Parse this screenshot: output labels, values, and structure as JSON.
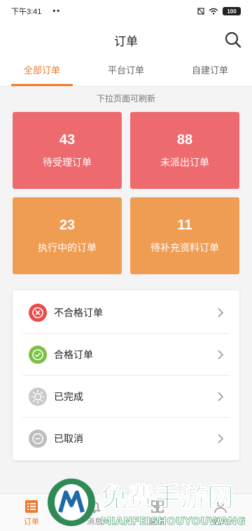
{
  "status_bar": {
    "time": "下午3:41",
    "dots": "••",
    "battery": "100"
  },
  "header": {
    "title": "订单"
  },
  "tabs": [
    {
      "label": "全部订单",
      "active": true
    },
    {
      "label": "平台订单",
      "active": false
    },
    {
      "label": "自建订单",
      "active": false
    }
  ],
  "refresh_hint": "下拉页面可刷新",
  "cards": [
    {
      "count": "43",
      "label": "待受理订单",
      "color": "#ed6b6f"
    },
    {
      "count": "88",
      "label": "未派出订单",
      "color": "#ed6b6f"
    },
    {
      "count": "23",
      "label": "执行中的订单",
      "color": "#f09d54"
    },
    {
      "count": "11",
      "label": "待补充资料订单",
      "color": "#f09d54"
    }
  ],
  "list": [
    {
      "label": "不合格订单",
      "icon": "x-circle-icon",
      "color": "#ea4b4b"
    },
    {
      "label": "合格订单",
      "icon": "check-circle-icon",
      "color": "#7cc242"
    },
    {
      "label": "已完成",
      "icon": "sun-icon",
      "color": "#c9c9c9"
    },
    {
      "label": "已取消",
      "icon": "minus-circle-icon",
      "color": "#bdbdbd"
    }
  ],
  "tabbar": [
    {
      "label": "订单",
      "icon": "order-list-icon",
      "active": true
    },
    {
      "label": "消息",
      "icon": "bell-icon",
      "active": false
    },
    {
      "label": "网络",
      "icon": "grid-icon",
      "active": false
    },
    {
      "label": "我的",
      "icon": "person-icon",
      "active": false
    }
  ],
  "watermark": {
    "title": "免费手游网",
    "subtitle": "MIANFEISHOUYOUWANG"
  },
  "colors": {
    "accent": "#f07a2c",
    "red_card": "#ed6b6f",
    "orange_card": "#f09d54"
  }
}
